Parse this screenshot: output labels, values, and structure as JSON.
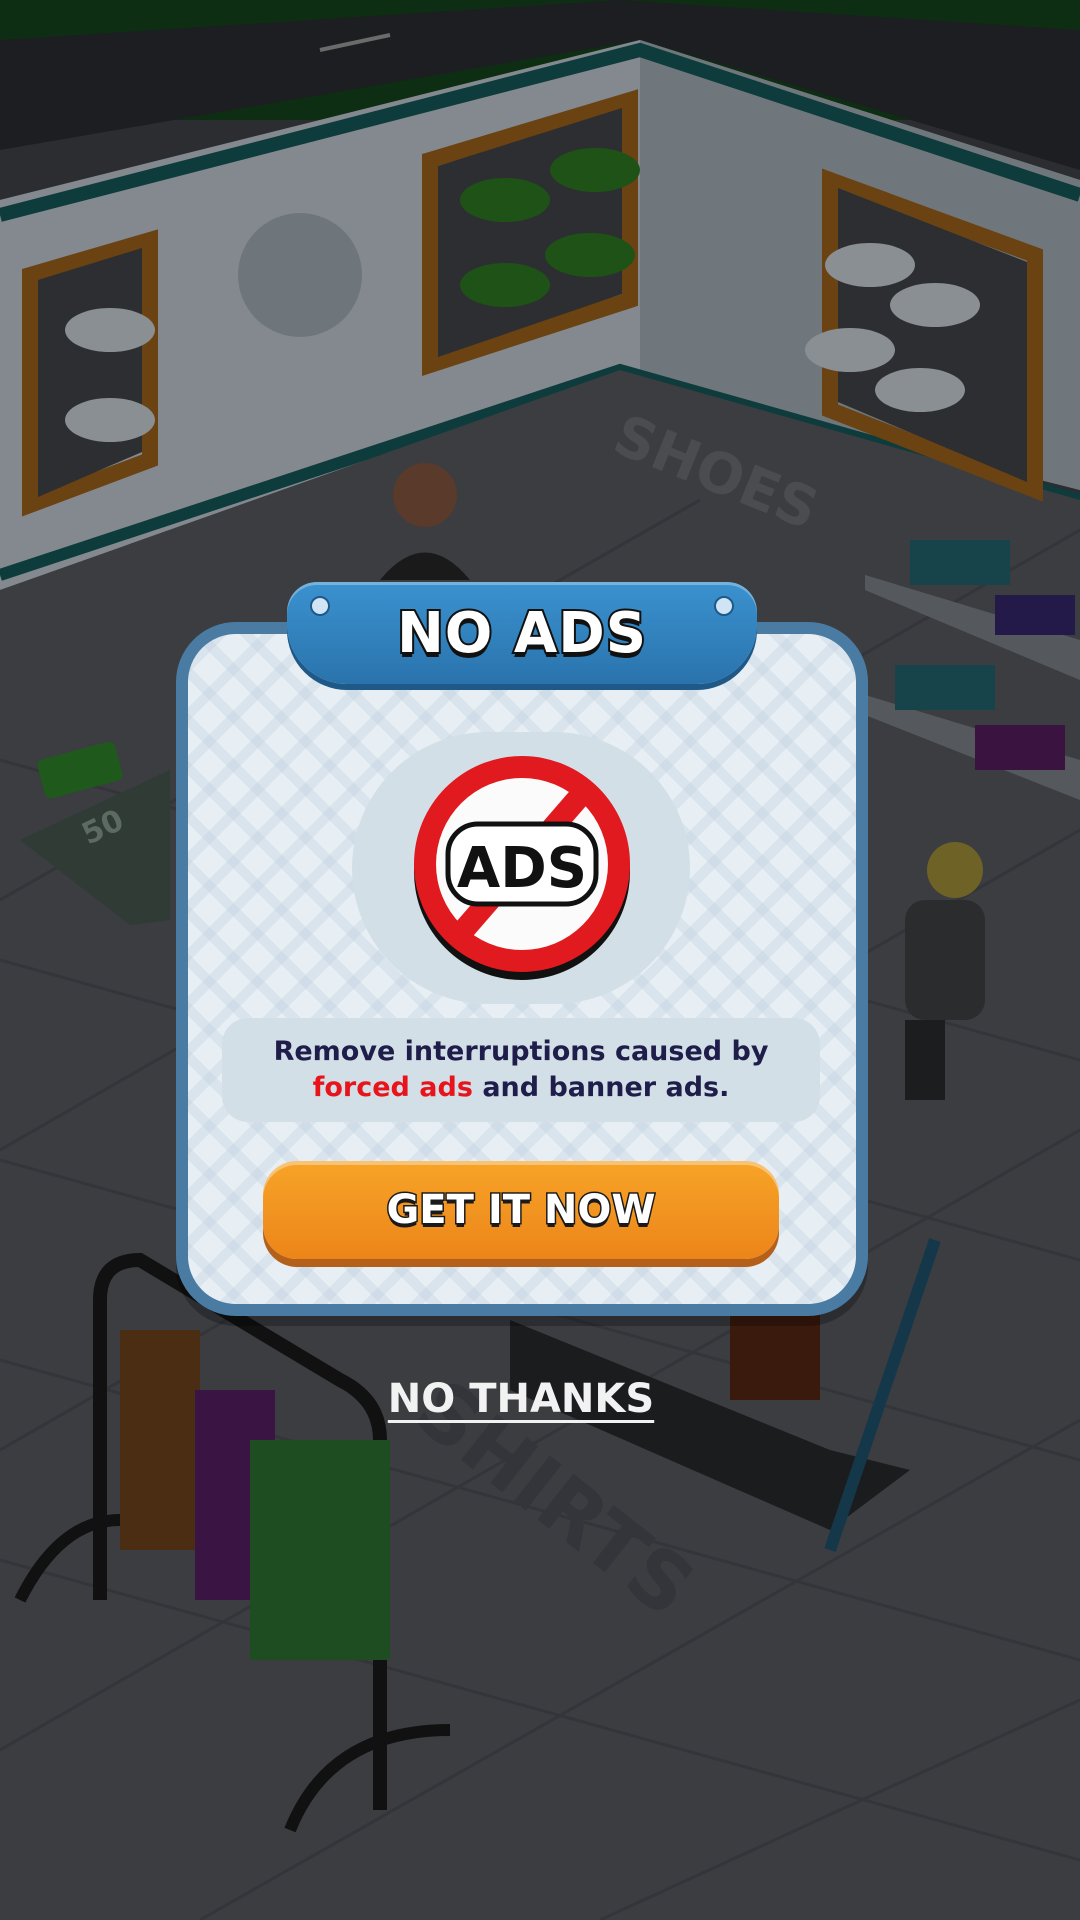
{
  "scene": {
    "floor_label_shoes": "SHOES",
    "floor_label_shirts": "SHIRTS",
    "pad_label": "50"
  },
  "popup": {
    "title": "NO ADS",
    "icon": "no-ads-icon",
    "icon_text": "ADS",
    "description_part1": "Remove interruptions caused by",
    "description_highlight": "forced ads",
    "description_part2": "and banner ads.",
    "button_label": "GET IT NOW",
    "dismiss_label": "NO THANKS"
  },
  "colors": {
    "accent_blue": "#2a73ad",
    "button_orange": "#ec8519",
    "highlight_red": "#e8141c",
    "text_navy": "#1f1d4a"
  }
}
